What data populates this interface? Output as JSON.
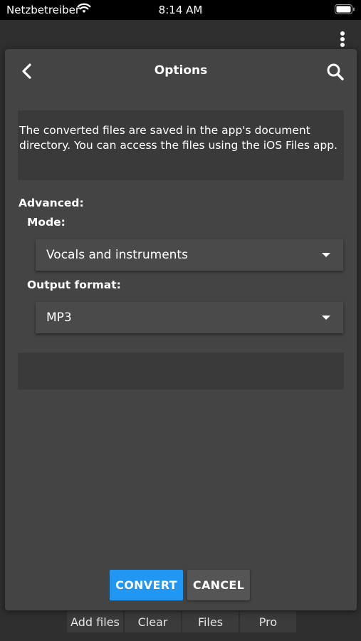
{
  "status_bar": {
    "carrier": "Netzbetreiber",
    "time": "8:14 AM",
    "icons": [
      "wifi-icon",
      "battery-icon"
    ]
  },
  "app": {
    "menu_icon": "more-vertical-icon",
    "tabs": [
      "Add files",
      "Clear",
      "Files",
      "Pro"
    ]
  },
  "dialog": {
    "title": "Options",
    "back_icon": "chevron-left-icon",
    "search_icon": "search-icon",
    "info_text": "The converted files are saved in the app's document directory. You can access the files using the iOS Files app.",
    "advanced_label": "Advanced:",
    "mode_label": "Mode:",
    "mode_value": "Vocals and instruments",
    "output_format_label": "Output format:",
    "output_format_value": "MP3",
    "convert_label": "CONVERT",
    "cancel_label": "CANCEL"
  },
  "colors": {
    "accent": "#2196f3",
    "dialog_bg": "#444444",
    "panel_bg": "#3a3a3a"
  }
}
